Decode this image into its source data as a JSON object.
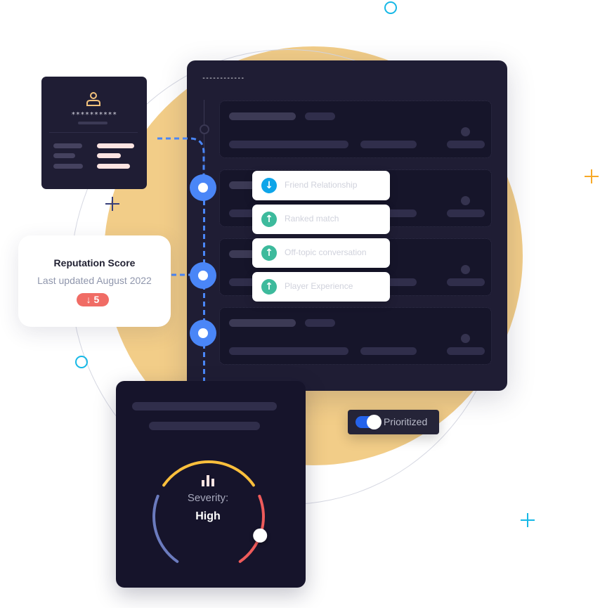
{
  "main_panel": {
    "title": "------------",
    "rows": [
      {
        "id": "row-1"
      },
      {
        "id": "row-2"
      },
      {
        "id": "row-3"
      },
      {
        "id": "row-4"
      }
    ]
  },
  "profile_card": {
    "icon": "user-icon",
    "masked_name": "**********"
  },
  "reputation": {
    "title": "Reputation Score",
    "subtitle": "Last updated August 2022",
    "change_icon": "arrow-down-icon",
    "change_value": "5",
    "badge_color": "#f06c65"
  },
  "factors": [
    {
      "label": "Friend Relationship",
      "direction": "down",
      "icon": "↓",
      "color": "#0ea5e9"
    },
    {
      "label": "Ranked match",
      "direction": "up",
      "icon": "↑",
      "color": "#3dba9c"
    },
    {
      "label": "Off-topic conversation",
      "direction": "up",
      "icon": "↑",
      "color": "#3dba9c"
    },
    {
      "label": "Player Experience",
      "direction": "up",
      "icon": "↑",
      "color": "#3dba9c"
    }
  ],
  "severity": {
    "label": "Severity:",
    "value": "High",
    "icon": "bar-chart-icon",
    "level_fraction": 0.88,
    "colors": {
      "low": "#6b7bbe",
      "medium": "#fbbf3c",
      "high": "#ef5b5b"
    }
  },
  "toggle": {
    "label": "Prioritized",
    "on": true,
    "color": "#2563eb"
  },
  "colors": {
    "accent_blue": "#4a86f7",
    "panel_bg": "#1f1d34",
    "sun": "#f2cd88",
    "deco_cyan": "#16b8e6",
    "deco_orange": "#f7a928",
    "deco_navy": "#39407a"
  }
}
